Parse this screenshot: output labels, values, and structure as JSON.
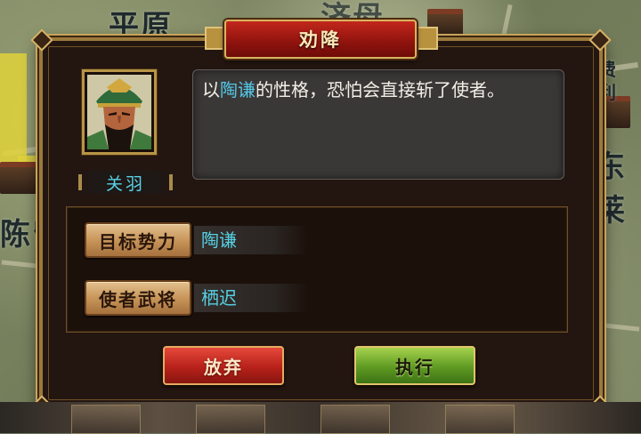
{
  "map": {
    "labels": [
      "平原",
      "济母",
      "东莱",
      "陈留",
      "费",
      "利"
    ]
  },
  "dialog": {
    "title": "劝降",
    "character_name": "关羽",
    "speech": {
      "prefix": "以",
      "highlight": "陶谦",
      "suffix": "的性格，恐怕会直接斩了使者。"
    },
    "fields": [
      {
        "label": "目标势力",
        "value": "陶谦"
      },
      {
        "label": "使者武将",
        "value": "栖迟"
      }
    ],
    "buttons": {
      "abandon": "放弃",
      "execute": "执行"
    }
  },
  "colors": {
    "highlight_text": "#53c6e6",
    "title_banner": "#a81a12",
    "abandon_button": "#b7221a",
    "execute_button": "#5e9a22"
  }
}
